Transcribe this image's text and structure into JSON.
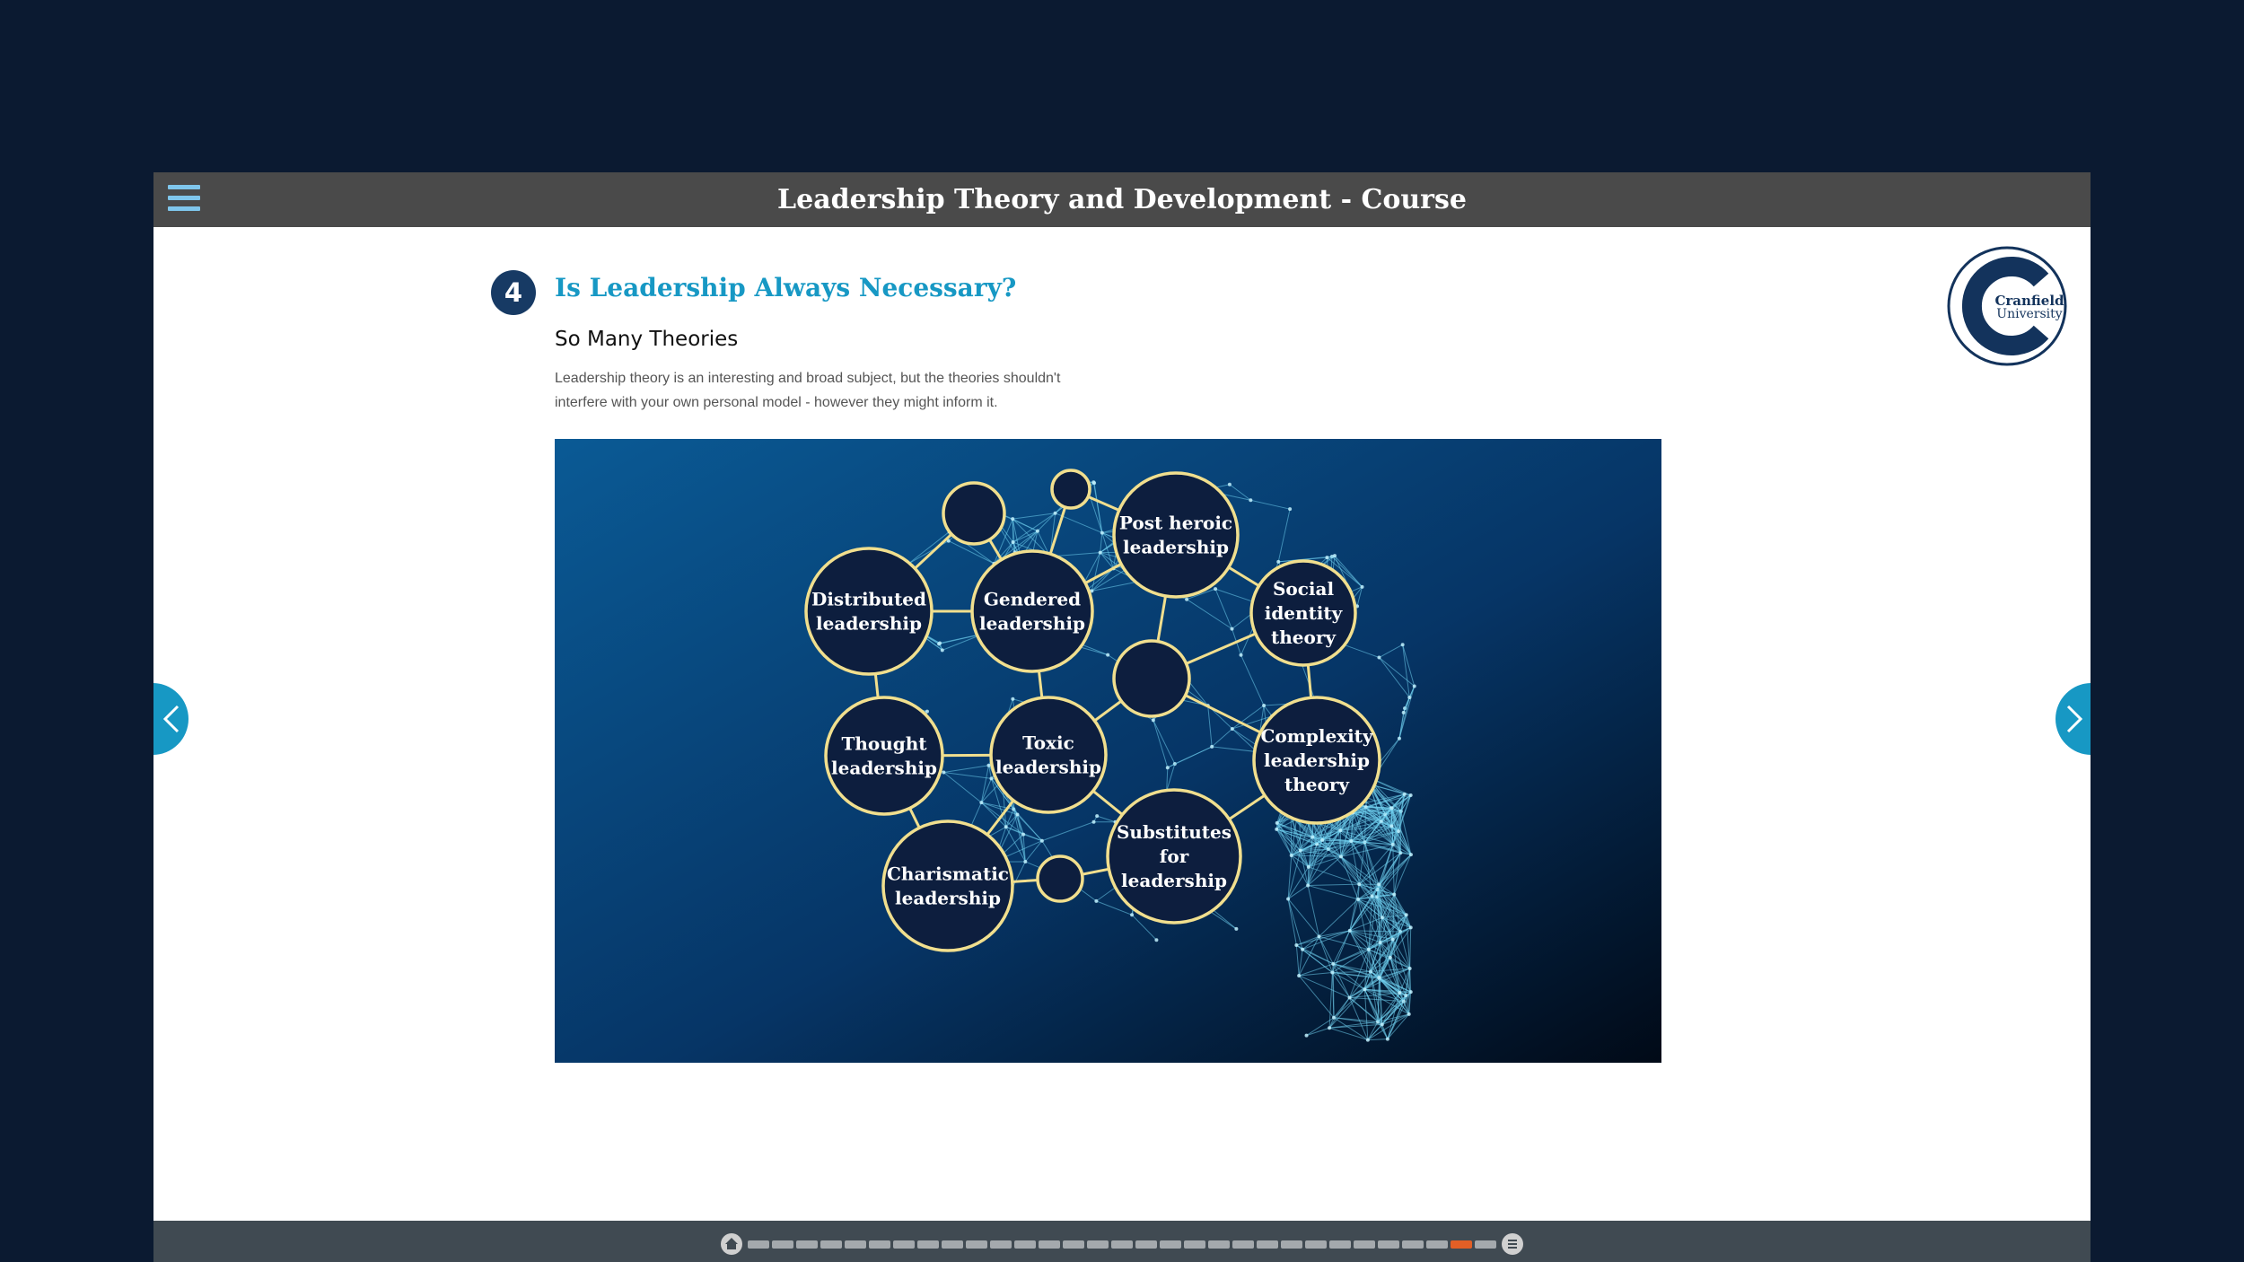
{
  "header": {
    "course_title": "Leadership Theory and Development - Course"
  },
  "logo": {
    "line1": "Cranfield",
    "line2": "University",
    "color": "#13335c"
  },
  "section": {
    "step_number": "4",
    "title": "Is Leadership Always Necessary?",
    "subtitle": "So Many Theories",
    "body_line1": "Leadership theory is an interesting and broad subject, but the theories shouldn't",
    "body_line2": "interfere with your own personal model - however they might inform it."
  },
  "diagram": {
    "nodes": [
      {
        "lines": [
          "Distributed",
          "leadership"
        ]
      },
      {
        "lines": [
          "Gendered",
          "leadership"
        ]
      },
      {
        "lines": [
          "Post heroic",
          "leadership"
        ]
      },
      {
        "lines": [
          "Social",
          "identity",
          "theory"
        ]
      },
      {
        "lines": [
          "Thought",
          "leadership"
        ]
      },
      {
        "lines": [
          "Toxic",
          "leadership"
        ]
      },
      {
        "lines": [
          "Complexity",
          "leadership",
          "theory"
        ]
      },
      {
        "lines": [
          "Substitutes",
          "for",
          "leadership"
        ]
      },
      {
        "lines": [
          "Charismatic",
          "leadership"
        ]
      }
    ]
  },
  "navigation": {
    "prev_icon": "chevron-left-icon",
    "next_icon": "chevron-right-icon",
    "menu_icon": "hamburger-menu-icon"
  },
  "progress": {
    "home_icon": "home-icon",
    "list_icon": "list-icon",
    "total_pages": 31,
    "current_page": 30,
    "active_color": "#e25f26"
  },
  "colors": {
    "accent": "#1798c4",
    "header_bar": "#4a4a4a",
    "background": "#0b1a31",
    "node_outline": "#f1df8e"
  }
}
